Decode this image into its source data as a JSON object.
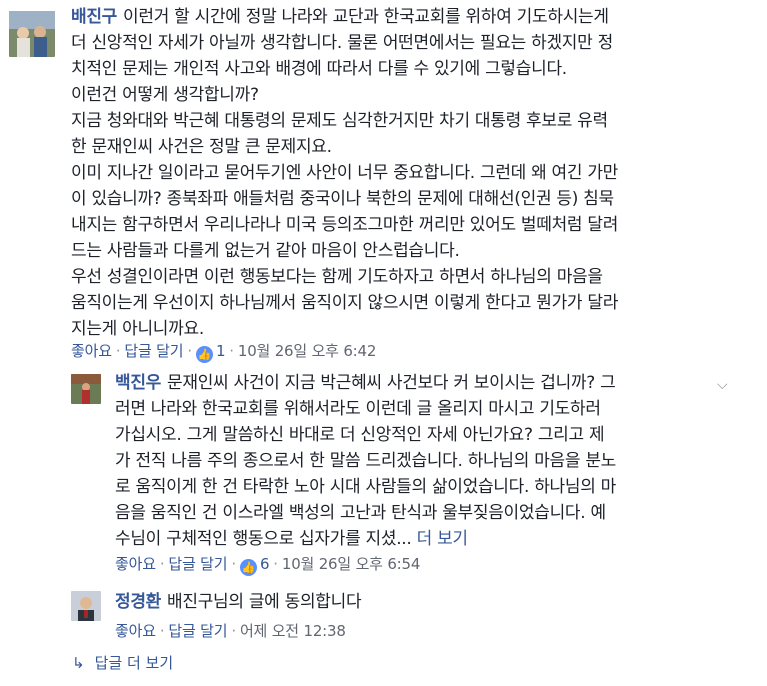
{
  "comment1": {
    "author": "배진구",
    "lines": [
      "이런거 할 시간에 정말 나라와 교단과 한국교회를 위하여 기도하시는게",
      "더 신앙적인 자세가 아닐까 생각합니다. 물론 어떤면에서는 필요는 하겠지만 정",
      "치적인 문제는 개인적 사고와 배경에 따라서 다를 수 있기에 그렇습니다.",
      "이런건 어떻게 생각합니까?",
      "지금 청와대와 박근혜 대통령의 문제도 심각한거지만 차기 대통령 후보로 유력",
      "한 문재인씨 사건은 정말 큰 문제지요.",
      "이미 지나간 일이라고 묻어두기엔 사안이 너무 중요합니다. 그런데 왜 여긴 가만",
      "이 있습니까? 종북좌파 애들처럼 중국이나 북한의 문제에 대해선(인권 등) 침묵",
      "내지는 함구하면서 우리나라나 미국 등의조그마한 꺼리만 있어도 벌떼처럼 달려",
      "드는 사람들과 다를게 없는거 같아 마음이 안스럽습니다.",
      "우선 성결인이라면 이런 행동보다는 함께 기도하자고 하면서 하나님의 마음을",
      "움직이는게 우선이지 하나님께서 움직이지 않으시면 이렇게 한다고 뭔가가 달라",
      "지는게 아니니까요."
    ],
    "like_label": "좋아요",
    "reply_label": "답글 달기",
    "like_count": "1",
    "timestamp": "10월 26일 오후 6:42"
  },
  "reply1": {
    "author": "백진우",
    "lines": [
      "문재인씨 사건이 지금 박근혜씨 사건보다 커 보이시는 겁니까? 그",
      "러면 나라와 한국교회를 위해서라도 이런데 글 올리지 마시고 기도하러",
      "가십시오. 그게 말씀하신 바대로 더 신앙적인 자세 아닌가요? 그리고 제",
      "가 전직 나름 주의 종으로서 한 말씀 드리겠습니다. 하나님의 마음을 분노",
      "로 움직이게 한 건 타락한 노아 시대 사람들의 삶이었습니다. 하나님의 마",
      "음을 움직인 건 이스라엘 백성의 고난과 탄식과 울부짖음이었습니다. 예",
      "수님이 구체적인 행동으로 십자가를 지셨..."
    ],
    "see_more": "더 보기",
    "like_label": "좋아요",
    "reply_label": "답글 달기",
    "like_count": "6",
    "timestamp": "10월 26일 오후 6:54"
  },
  "reply2": {
    "author": "정경환",
    "text": "배진구님의 글에 동의합니다",
    "like_label": "좋아요",
    "reply_label": "답글 달기",
    "timestamp": "어제 오전 12:38"
  },
  "more_replies": "답글 더 보기",
  "colors": {
    "link": "#365899",
    "meta": "#616770",
    "like_badge": "#5890ff"
  }
}
